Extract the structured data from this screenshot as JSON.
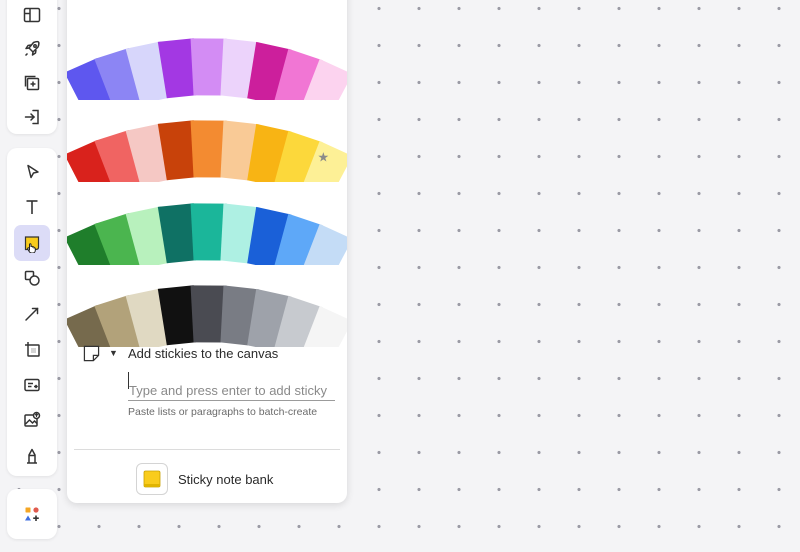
{
  "toolbar_top": {
    "items": [
      {
        "name": "panel-layout-icon"
      },
      {
        "name": "rocket-icon"
      },
      {
        "name": "add-frame-icon"
      },
      {
        "name": "exit-icon"
      }
    ]
  },
  "toolbar_main": {
    "items": [
      {
        "name": "select-cursor-icon"
      },
      {
        "name": "text-icon"
      },
      {
        "name": "sticky-note-icon",
        "active": true
      },
      {
        "name": "shapes-icon"
      },
      {
        "name": "connector-line-icon"
      },
      {
        "name": "frame-icon"
      },
      {
        "name": "card-icon"
      },
      {
        "name": "image-upload-icon"
      },
      {
        "name": "pen-icon"
      }
    ]
  },
  "toolbar_bottom": {
    "items": [
      {
        "name": "more-apps-icon"
      }
    ]
  },
  "sticky_panel": {
    "palettes": [
      {
        "name": "purple-pink",
        "colors": [
          "#5e57ef",
          "#8c85f4",
          "#d7d6fb",
          "#a338e3",
          "#d38cf4",
          "#ecd3fb",
          "#cc1f9c",
          "#f176d4",
          "#fcd3ef"
        ]
      },
      {
        "name": "warm",
        "colors": [
          "#d9221c",
          "#f06462",
          "#f5c8c4",
          "#c8420a",
          "#f38b31",
          "#f9ca96",
          "#f8b414",
          "#fcd83b",
          "#fdf096"
        ],
        "starred_index": 8
      },
      {
        "name": "cool",
        "colors": [
          "#1f7e2b",
          "#4bb54f",
          "#b8f1bd",
          "#0f7164",
          "#1bb69a",
          "#aef0e3",
          "#1a60d8",
          "#5ea8f8",
          "#c4dcf6"
        ]
      },
      {
        "name": "neutral",
        "colors": [
          "#766a4d",
          "#b2a27a",
          "#e0d9c2",
          "#111111",
          "#4a4b52",
          "#797c84",
          "#9ea2aa",
          "#c7cacf",
          "#f5f5f5"
        ]
      }
    ],
    "add_title": "Add stickies to the canvas",
    "input_placeholder": "Type and press enter to add sticky",
    "hint": "Paste lists or paragraphs to batch-create",
    "bank_label": "Sticky note bank",
    "accent": "#f9cc1c"
  }
}
